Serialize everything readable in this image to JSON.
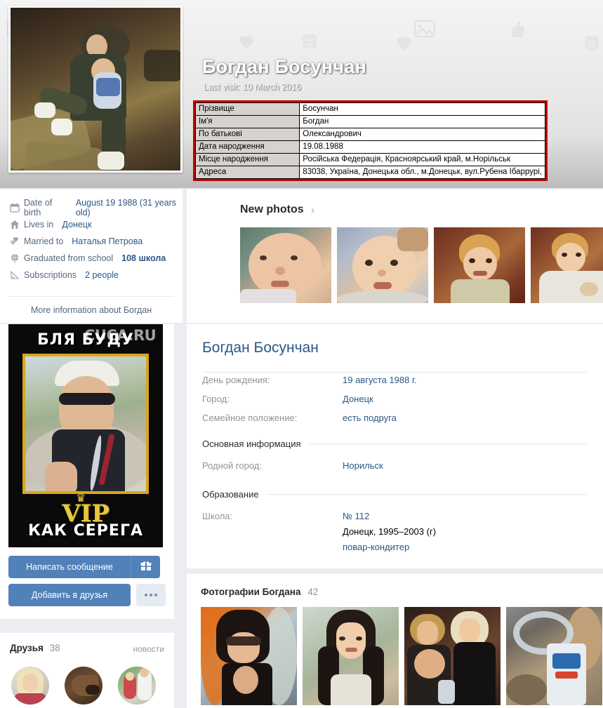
{
  "header": {
    "profile_name": "Богдан Босунчан",
    "last_visit": "Last visit: 10 March 2016",
    "cover_photo_alt": "man sitting on rocks with child"
  },
  "document_table": {
    "border_color": "#c00000",
    "rows": [
      {
        "label": "Прізвище",
        "value": "Босунчан"
      },
      {
        "label": "Ім'я",
        "value": "Богдан"
      },
      {
        "label": "По батькові",
        "value": "Олександрович"
      },
      {
        "label": "Дата народження",
        "value": "19.08.1988"
      },
      {
        "label": "Місце народження",
        "value": "Російська Федерація, Красноярський край, м.Норільськ"
      },
      {
        "label": "Адреса",
        "value": "83038, Україна, Донецька обл., м.Донецьк, вул.Рубена Ібаррурі,"
      }
    ]
  },
  "info_panel": {
    "rows": [
      {
        "icon": "calendar-icon",
        "label": "Date of birth",
        "value": "August 19 1988 (31 years old)",
        "bold": false
      },
      {
        "icon": "home-icon",
        "label": "Lives in",
        "value": "Донецк",
        "bold": false
      },
      {
        "icon": "hearts-icon",
        "label": "Married to",
        "value": "Наталья Петрова",
        "bold": false
      },
      {
        "icon": "globe-icon",
        "label": "Graduated from school",
        "value": "108 школа",
        "bold": true
      },
      {
        "icon": "rss-icon",
        "label": "Subscriptions",
        "value": "2 people",
        "bold": false
      }
    ],
    "more_link": "More information about Богдан"
  },
  "new_photos": {
    "title": "New photos",
    "chevron": "›",
    "thumbs": [
      {
        "name": "baby-closeup-green-wall"
      },
      {
        "name": "baby-on-pillow"
      },
      {
        "name": "toddler-on-carpet"
      },
      {
        "name": "toddler-in-white-shirt"
      }
    ]
  },
  "vip_banner": {
    "top_text": "БЛЯ БУДУ",
    "logo_text": "VIP",
    "bottom_text": "КАК СЕРЕГА",
    "watermark": "CUCA.RU",
    "photo_alt": "young man in white cap and sunglasses"
  },
  "actions": {
    "message_label": "Написать сообщение",
    "gift_icon": "gift-icon",
    "add_friend_label": "Добавить в друзья",
    "more_icon": "three-dots-icon",
    "primary_color": "#5181b8"
  },
  "friends": {
    "title": "Друзья",
    "count": "38",
    "news_link": "новости",
    "avatars": [
      {
        "name": "blonde-woman-avatar"
      },
      {
        "name": "dog-avatar"
      },
      {
        "name": "couple-avatar"
      }
    ]
  },
  "profile": {
    "name": "Богдан Босунчан",
    "fields": [
      {
        "key": "День рождения:",
        "value": "19 августа 1988 г."
      },
      {
        "key": "Город:",
        "value": "Донецк"
      },
      {
        "key": "Семейное положение:",
        "value": "есть подруга"
      }
    ],
    "section_main": "Основная информация",
    "main_fields": [
      {
        "key": "Родной город:",
        "value": "Норильск"
      }
    ],
    "section_education": "Образование",
    "school": {
      "key": "Школа:",
      "number": "№ 112",
      "place_years": "Донецк, 1995–2003 (г)",
      "specialty": "повар-кондитер"
    }
  },
  "photos": {
    "title": "Фотографии Богдана",
    "count": "42",
    "thumbs": [
      {
        "name": "woman-in-shop-sunglasses"
      },
      {
        "name": "dark-haired-woman-portrait"
      },
      {
        "name": "two-women-at-party"
      },
      {
        "name": "milk-carton-and-tubing"
      }
    ]
  }
}
